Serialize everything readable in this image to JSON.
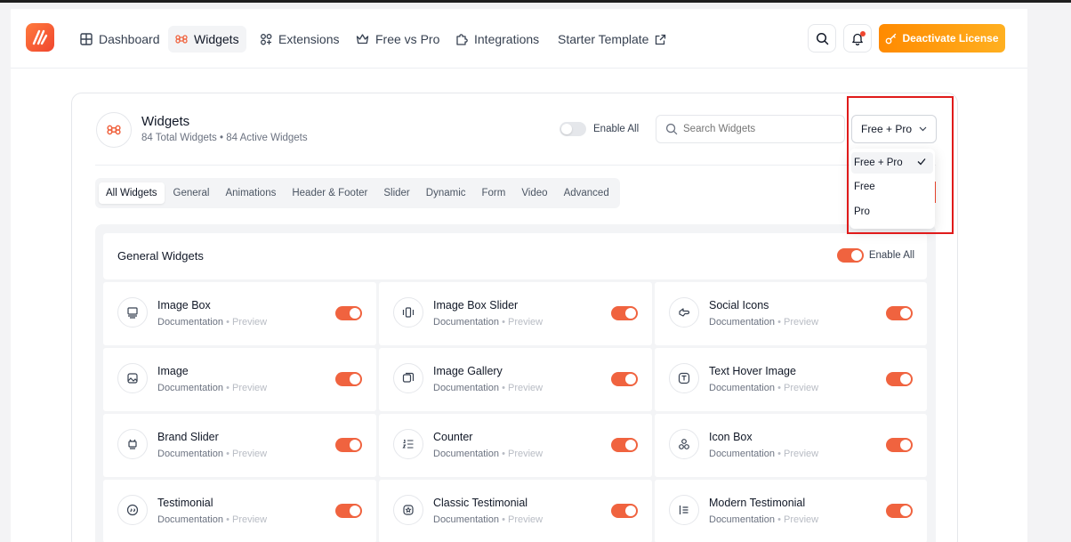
{
  "nav": {
    "items": [
      {
        "label": "Dashboard",
        "icon": "grid-icon"
      },
      {
        "label": "Widgets",
        "icon": "command-icon",
        "active": true
      },
      {
        "label": "Extensions",
        "icon": "extensions-icon"
      },
      {
        "label": "Free vs Pro",
        "icon": "crown-icon"
      },
      {
        "label": "Integrations",
        "icon": "puzzle-icon"
      },
      {
        "label": "Starter Template",
        "icon": "external-link-icon"
      }
    ],
    "cta_label": "Deactivate License"
  },
  "header": {
    "title": "Widgets",
    "subtitle": "84 Total Widgets • 84 Active Widgets",
    "enable_all_label": "Enable All",
    "search_placeholder": "Search Widgets",
    "filter_value": "Free + Pro"
  },
  "tabs": [
    "All Widgets",
    "General",
    "Animations",
    "Header & Footer",
    "Slider",
    "Dynamic",
    "Form",
    "Video",
    "Advanced"
  ],
  "section": {
    "title": "General Widgets",
    "enable_all_label": "Enable All"
  },
  "widgets": [
    {
      "title": "Image Box",
      "doc": "Documentation",
      "sep": "•",
      "preview": "Preview",
      "icon": "image-box-icon"
    },
    {
      "title": "Image Box Slider",
      "doc": "Documentation",
      "sep": "•",
      "preview": "Preview",
      "icon": "slider-icon"
    },
    {
      "title": "Social Icons",
      "doc": "Documentation",
      "sep": "•",
      "preview": "Preview",
      "icon": "social-icon"
    },
    {
      "title": "Image",
      "doc": "Documentation",
      "sep": "•",
      "preview": "Preview",
      "icon": "image-icon"
    },
    {
      "title": "Image Gallery",
      "doc": "Documentation",
      "sep": "•",
      "preview": "Preview",
      "icon": "gallery-icon"
    },
    {
      "title": "Text Hover Image",
      "doc": "Documentation",
      "sep": "•",
      "preview": "Preview",
      "icon": "text-icon"
    },
    {
      "title": "Brand Slider",
      "doc": "Documentation",
      "sep": "•",
      "preview": "Preview",
      "icon": "brand-icon"
    },
    {
      "title": "Counter",
      "doc": "Documentation",
      "sep": "•",
      "preview": "Preview",
      "icon": "counter-icon"
    },
    {
      "title": "Icon Box",
      "doc": "Documentation",
      "sep": "•",
      "preview": "Preview",
      "icon": "icon-box-icon"
    },
    {
      "title": "Testimonial",
      "doc": "Documentation",
      "sep": "•",
      "preview": "Preview",
      "icon": "quote-icon"
    },
    {
      "title": "Classic Testimonial",
      "doc": "Documentation",
      "sep": "•",
      "preview": "Preview",
      "icon": "classic-quote-icon"
    },
    {
      "title": "Modern Testimonial",
      "doc": "Documentation",
      "sep": "•",
      "preview": "Preview",
      "icon": "modern-quote-icon"
    }
  ],
  "dropdown": {
    "options": [
      "Free + Pro",
      "Free",
      "Pro"
    ],
    "selected": "Free + Pro"
  },
  "colors": {
    "accent": "#f0633f",
    "cta_start": "#ff8a00",
    "highlight": "#e01b1b"
  }
}
